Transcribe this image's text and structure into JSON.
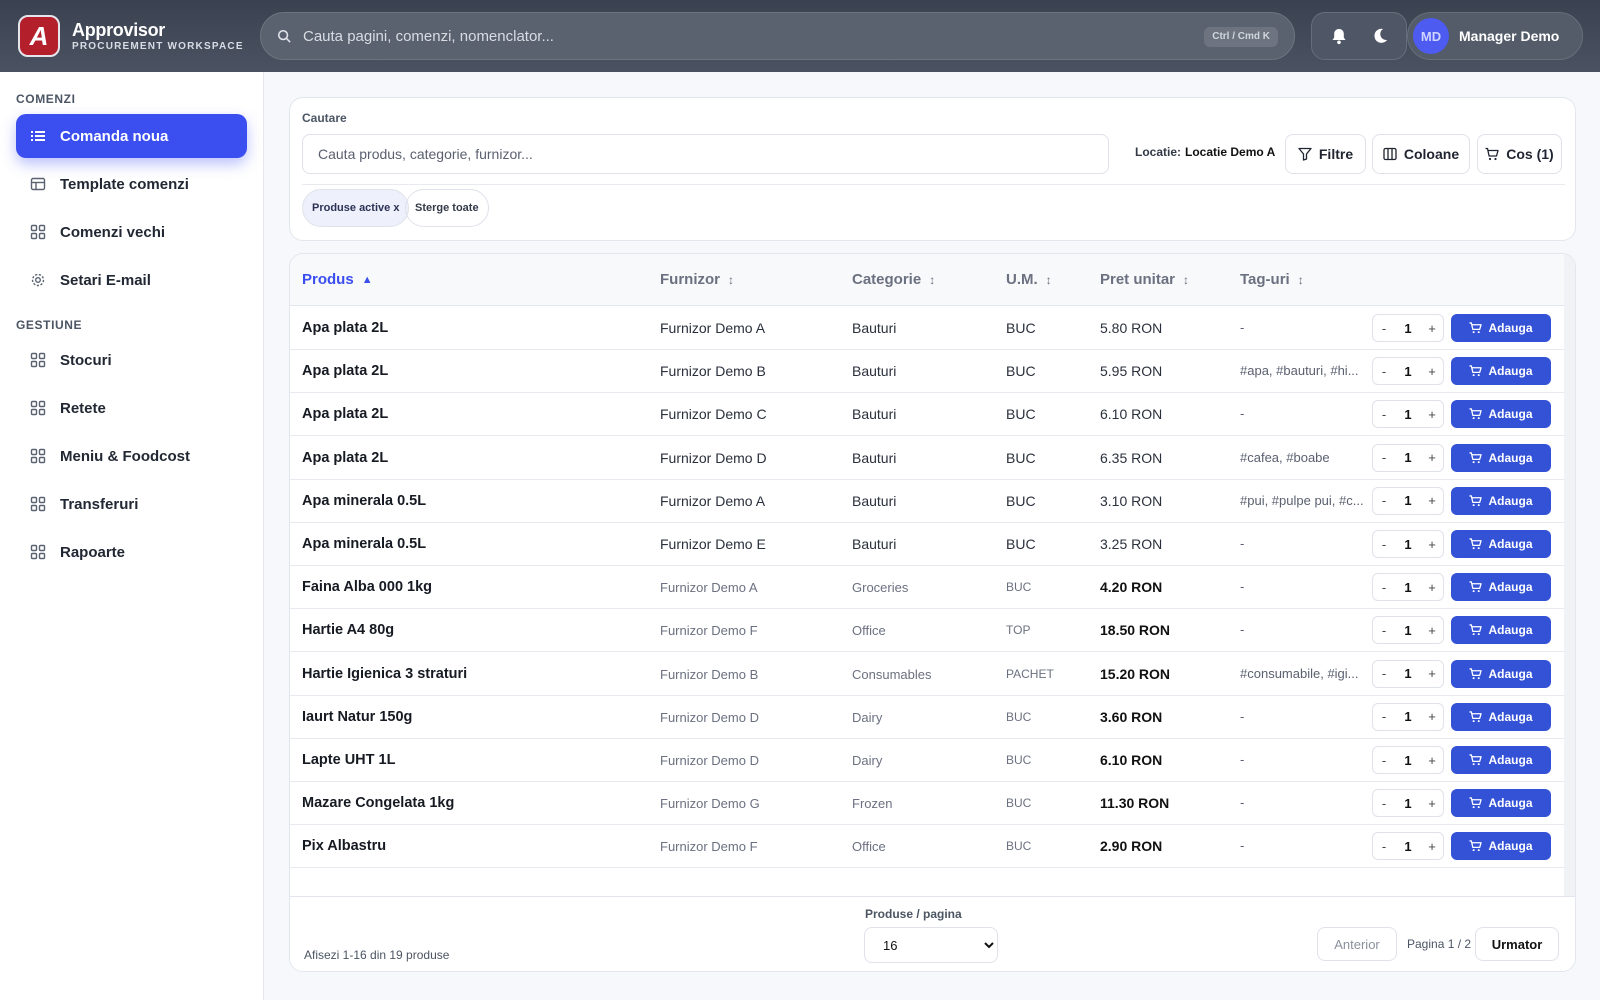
{
  "brand": {
    "name": "Approvisor",
    "subtitle": "PROCUREMENT WORKSPACE",
    "logo_letter": "A"
  },
  "topbar": {
    "search_placeholder": "Cauta pagini, comenzi, nomenclator...",
    "shortcut": "Ctrl / Cmd K",
    "user_initials": "MD",
    "user_name": "Manager Demo",
    "icons": [
      "bell-icon",
      "moon-icon"
    ]
  },
  "sidebar": {
    "sections": [
      {
        "title": "COMENZI",
        "items": [
          {
            "label": "Comanda noua",
            "icon": "list-icon",
            "active": true
          },
          {
            "label": "Template comenzi",
            "icon": "table-icon"
          },
          {
            "label": "Comenzi vechi",
            "icon": "grid-icon"
          },
          {
            "label": "Setari E-mail",
            "icon": "gear-icon"
          }
        ]
      },
      {
        "title": "GESTIUNE",
        "items": [
          {
            "label": "Stocuri",
            "icon": "grid-icon"
          },
          {
            "label": "Retete",
            "icon": "grid-icon"
          },
          {
            "label": "Meniu & Foodcost",
            "icon": "grid-icon"
          },
          {
            "label": "Transferuri",
            "icon": "grid-icon"
          },
          {
            "label": "Rapoarte",
            "icon": "grid-icon"
          }
        ]
      }
    ]
  },
  "filters": {
    "label": "Cautare",
    "placeholder": "Cauta produs, categorie, furnizor...",
    "location_label": "Locatie:",
    "location_value": "Locatie Demo A",
    "filters_btn": "Filtre",
    "columns_btn": "Coloane",
    "cart_btn": "Cos (1)",
    "chips": [
      "Produse active x",
      "Sterge toate"
    ]
  },
  "table": {
    "columns": [
      "Produs",
      "Furnizor",
      "Categorie",
      "U.M.",
      "Pret unitar",
      "Tag-uri"
    ],
    "sorted_column": "Produs",
    "add_label": "Adauga",
    "rows": [
      {
        "product": "Apa plata 2L",
        "supplier": "Furnizor Demo A",
        "category": "Bauturi",
        "um": "BUC",
        "price": "5.80 RON",
        "tags": "-",
        "qty": "1"
      },
      {
        "product": "Apa plata 2L",
        "supplier": "Furnizor Demo B",
        "category": "Bauturi",
        "um": "BUC",
        "price": "5.95 RON",
        "tags": "#apa, #bauturi, #hi...",
        "qty": "1"
      },
      {
        "product": "Apa plata 2L",
        "supplier": "Furnizor Demo C",
        "category": "Bauturi",
        "um": "BUC",
        "price": "6.10 RON",
        "tags": "-",
        "qty": "1"
      },
      {
        "product": "Apa plata 2L",
        "supplier": "Furnizor Demo D",
        "category": "Bauturi",
        "um": "BUC",
        "price": "6.35 RON",
        "tags": "#cafea, #boabe",
        "qty": "1"
      },
      {
        "product": "Apa minerala 0.5L",
        "supplier": "Furnizor Demo A",
        "category": "Bauturi",
        "um": "BUC",
        "price": "3.10 RON",
        "tags": "#pui, #pulpe pui, #c...",
        "qty": "1"
      },
      {
        "product": "Apa minerala 0.5L",
        "supplier": "Furnizor Demo E",
        "category": "Bauturi",
        "um": "BUC",
        "price": "3.25 RON",
        "tags": "-",
        "qty": "1"
      },
      {
        "product": "Faina Alba 000 1kg",
        "supplier": "Furnizor Demo A",
        "category": "Groceries",
        "um": "BUC",
        "price": "4.20 RON",
        "tags": "-",
        "qty": "1",
        "muted": true
      },
      {
        "product": "Hartie A4 80g",
        "supplier": "Furnizor Demo F",
        "category": "Office",
        "um": "TOP",
        "price": "18.50 RON",
        "tags": "-",
        "qty": "1",
        "muted": true
      },
      {
        "product": "Hartie Igienica 3 straturi",
        "supplier": "Furnizor Demo B",
        "category": "Consumables",
        "um": "PACHET",
        "price": "15.20 RON",
        "tags": "#consumabile, #igi...",
        "qty": "1",
        "muted": true
      },
      {
        "product": "Iaurt Natur 150g",
        "supplier": "Furnizor Demo D",
        "category": "Dairy",
        "um": "BUC",
        "price": "3.60 RON",
        "tags": "-",
        "qty": "1",
        "muted": true
      },
      {
        "product": "Lapte UHT 1L",
        "supplier": "Furnizor Demo D",
        "category": "Dairy",
        "um": "BUC",
        "price": "6.10 RON",
        "tags": "-",
        "qty": "1",
        "muted": true
      },
      {
        "product": "Mazare Congelata 1kg",
        "supplier": "Furnizor Demo G",
        "category": "Frozen",
        "um": "BUC",
        "price": "11.30 RON",
        "tags": "-",
        "qty": "1",
        "muted": true
      },
      {
        "product": "Pix Albastru",
        "supplier": "Furnizor Demo F",
        "category": "Office",
        "um": "BUC",
        "price": "2.90 RON",
        "tags": "-",
        "qty": "1",
        "muted": true
      }
    ]
  },
  "footer": {
    "showing": "Afisezi 1-16 din 19 produse",
    "per_page_label": "Produse / pagina",
    "per_page_value": "16",
    "prev": "Anterior",
    "page_info": "Pagina 1 / 2",
    "next": "Urmator"
  },
  "colors": {
    "accent": "#3b4ef0",
    "button": "#3452d6",
    "topbar": "#3a4150",
    "logo": "#b3202c"
  }
}
